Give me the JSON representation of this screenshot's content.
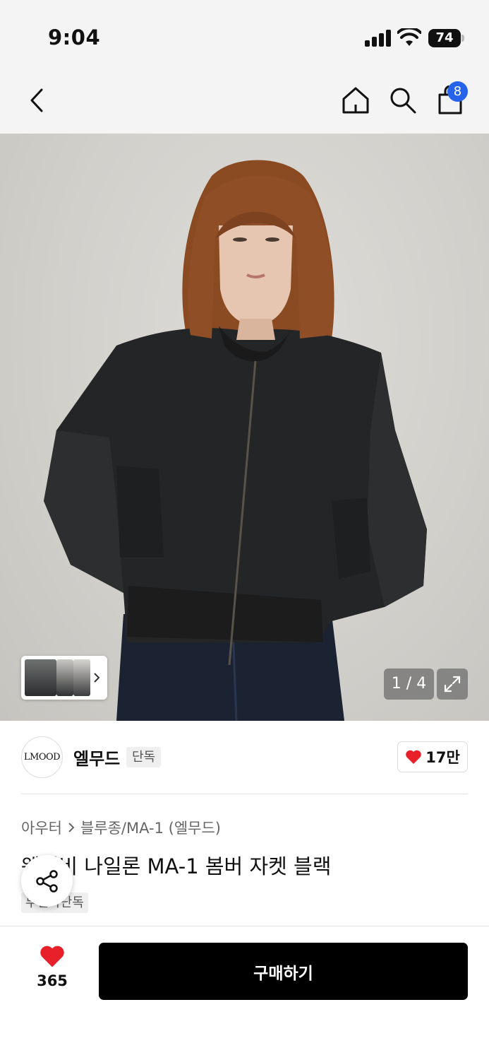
{
  "status_bar": {
    "time": "9:04",
    "battery": "74"
  },
  "nav": {
    "cart_count": "8",
    "icons": [
      "back-arrow-icon",
      "home-icon",
      "search-icon",
      "shopping-bag-icon"
    ]
  },
  "gallery": {
    "pager": "1 / 4"
  },
  "brand": {
    "logo_text": "LMOOD",
    "name": "엘무드",
    "tag": "단독",
    "likes": "17만"
  },
  "product": {
    "breadcrumb": [
      "아우터",
      "블루종/MA-1 (엘무드)"
    ],
    "title": "웨버비 나일론 MA-1 봄버 자켓 블랙",
    "tag": "무신사단독"
  },
  "bottom_bar": {
    "wish_count": "365",
    "buy_label": "구매하기"
  },
  "colors": {
    "accent_badge": "#2563eb",
    "heart": "#e8202a",
    "buy_button": "#000000"
  }
}
